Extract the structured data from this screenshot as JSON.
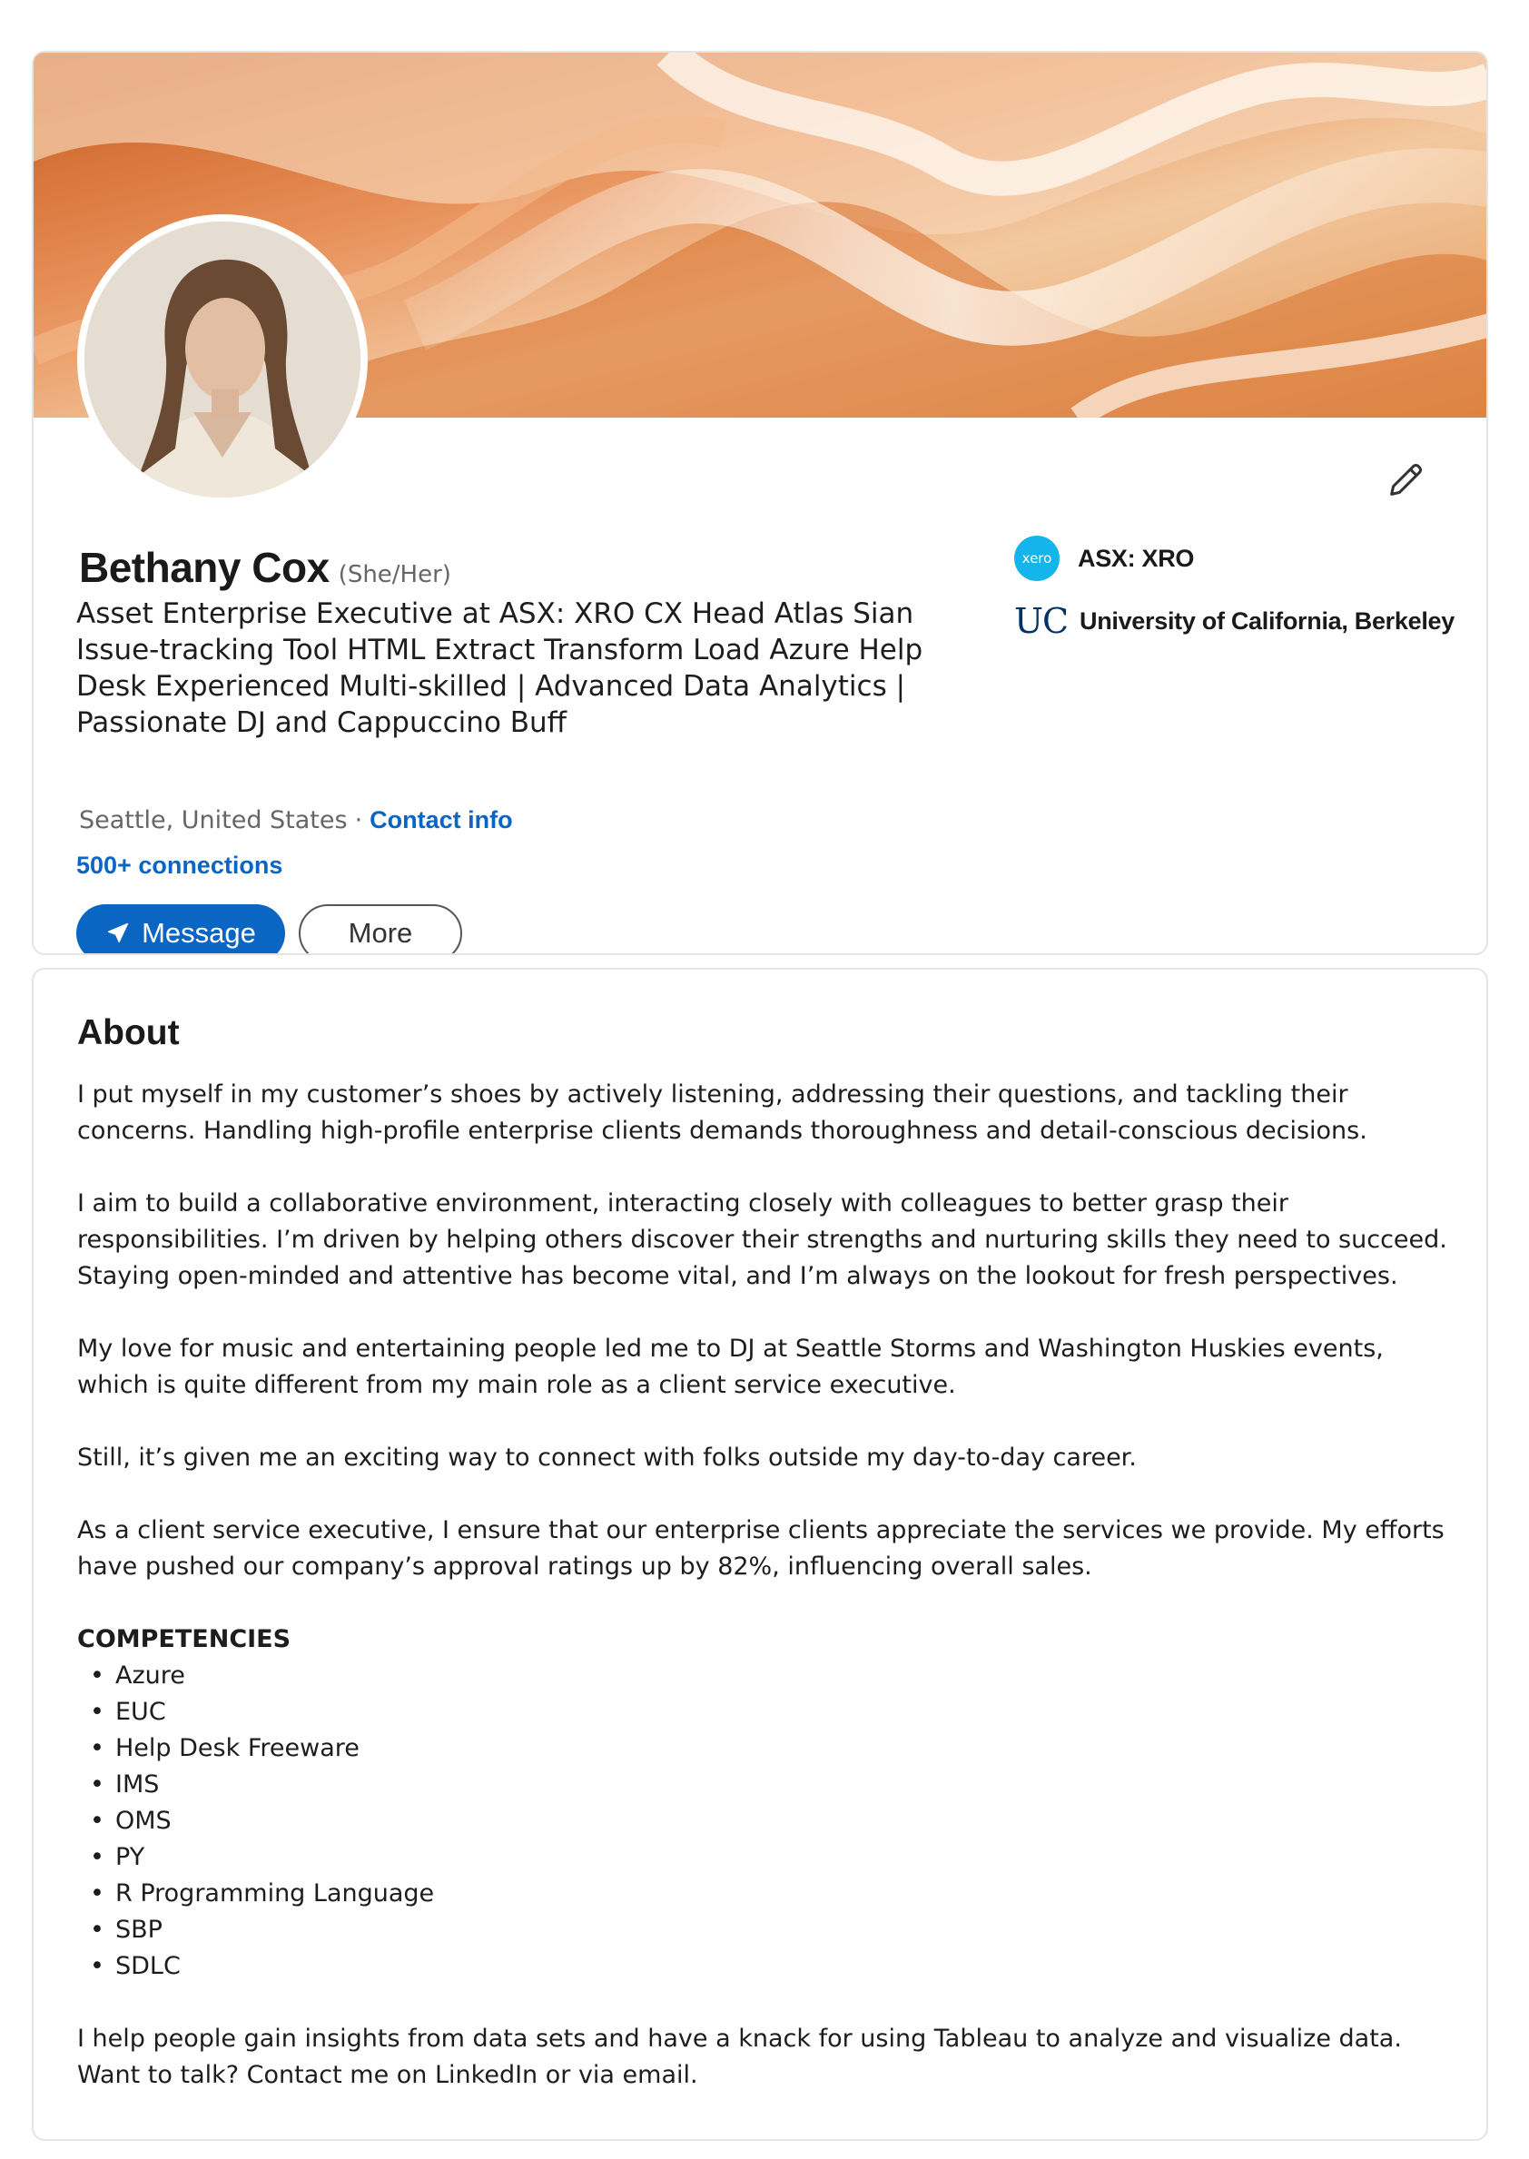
{
  "profile": {
    "name": "Bethany Cox",
    "pronouns": "(She/Her)",
    "headline": "Asset Enterprise Executive at ASX: XRO   CX Head    Atlas Sian Issue-tracking Tool   HTML   Extract Transform Load   Azure   Help Desk Experienced   Multi-skilled | Advanced Data Analytics | Passionate DJ and Cappuccino Buff",
    "location": "Seattle, United States",
    "separator": "·",
    "contact_label": "Contact info",
    "connections": "500+ connections",
    "message_label": "Message",
    "more_label": "More",
    "edit_icon": "pencil-icon",
    "accent_color": "#0a66c2"
  },
  "organizations": [
    {
      "logo_text": "xero",
      "name": "ASX: XRO",
      "logo_color": "#13b5ea"
    },
    {
      "logo_text": "UC",
      "name": "University of California, Berkeley",
      "logo_color": "#003262"
    }
  ],
  "about": {
    "title": "About",
    "paragraphs": [
      "I put myself in my customer’s shoes by actively listening, addressing their questions, and tackling their concerns. Handling high-profile enterprise clients demands thoroughness and detail-conscious decisions.",
      "I aim to build a collaborative environment, interacting closely with colleagues to better grasp their responsibilities. I’m driven by helping others discover their strengths and nurturing skills they need to succeed. Staying open-minded and attentive has become vital, and I’m always on the lookout for fresh perspectives.",
      "My love for music and entertaining people led me to DJ at Seattle Storms and Washington Huskies events, which is quite different from my main role as a client service executive.",
      "Still, it’s given me an exciting way to connect with folks outside my day-to-day career.",
      "As a client service executive, I ensure that our enterprise clients appreciate the services we provide. My efforts have pushed our company’s approval ratings up by 82%, influencing overall sales."
    ],
    "competencies_title": "COMPETENCIES",
    "competencies": [
      "Azure",
      "EUC",
      "Help Desk Freeware",
      "IMS",
      "OMS",
      "PY",
      "R Programming Language",
      "SBP",
      "SDLC"
    ],
    "closing_1": "I help people gain insights from data sets and have a knack for using Tableau to analyze and visualize data.",
    "closing_2": "Want to talk? Contact me on LinkedIn or via email."
  }
}
